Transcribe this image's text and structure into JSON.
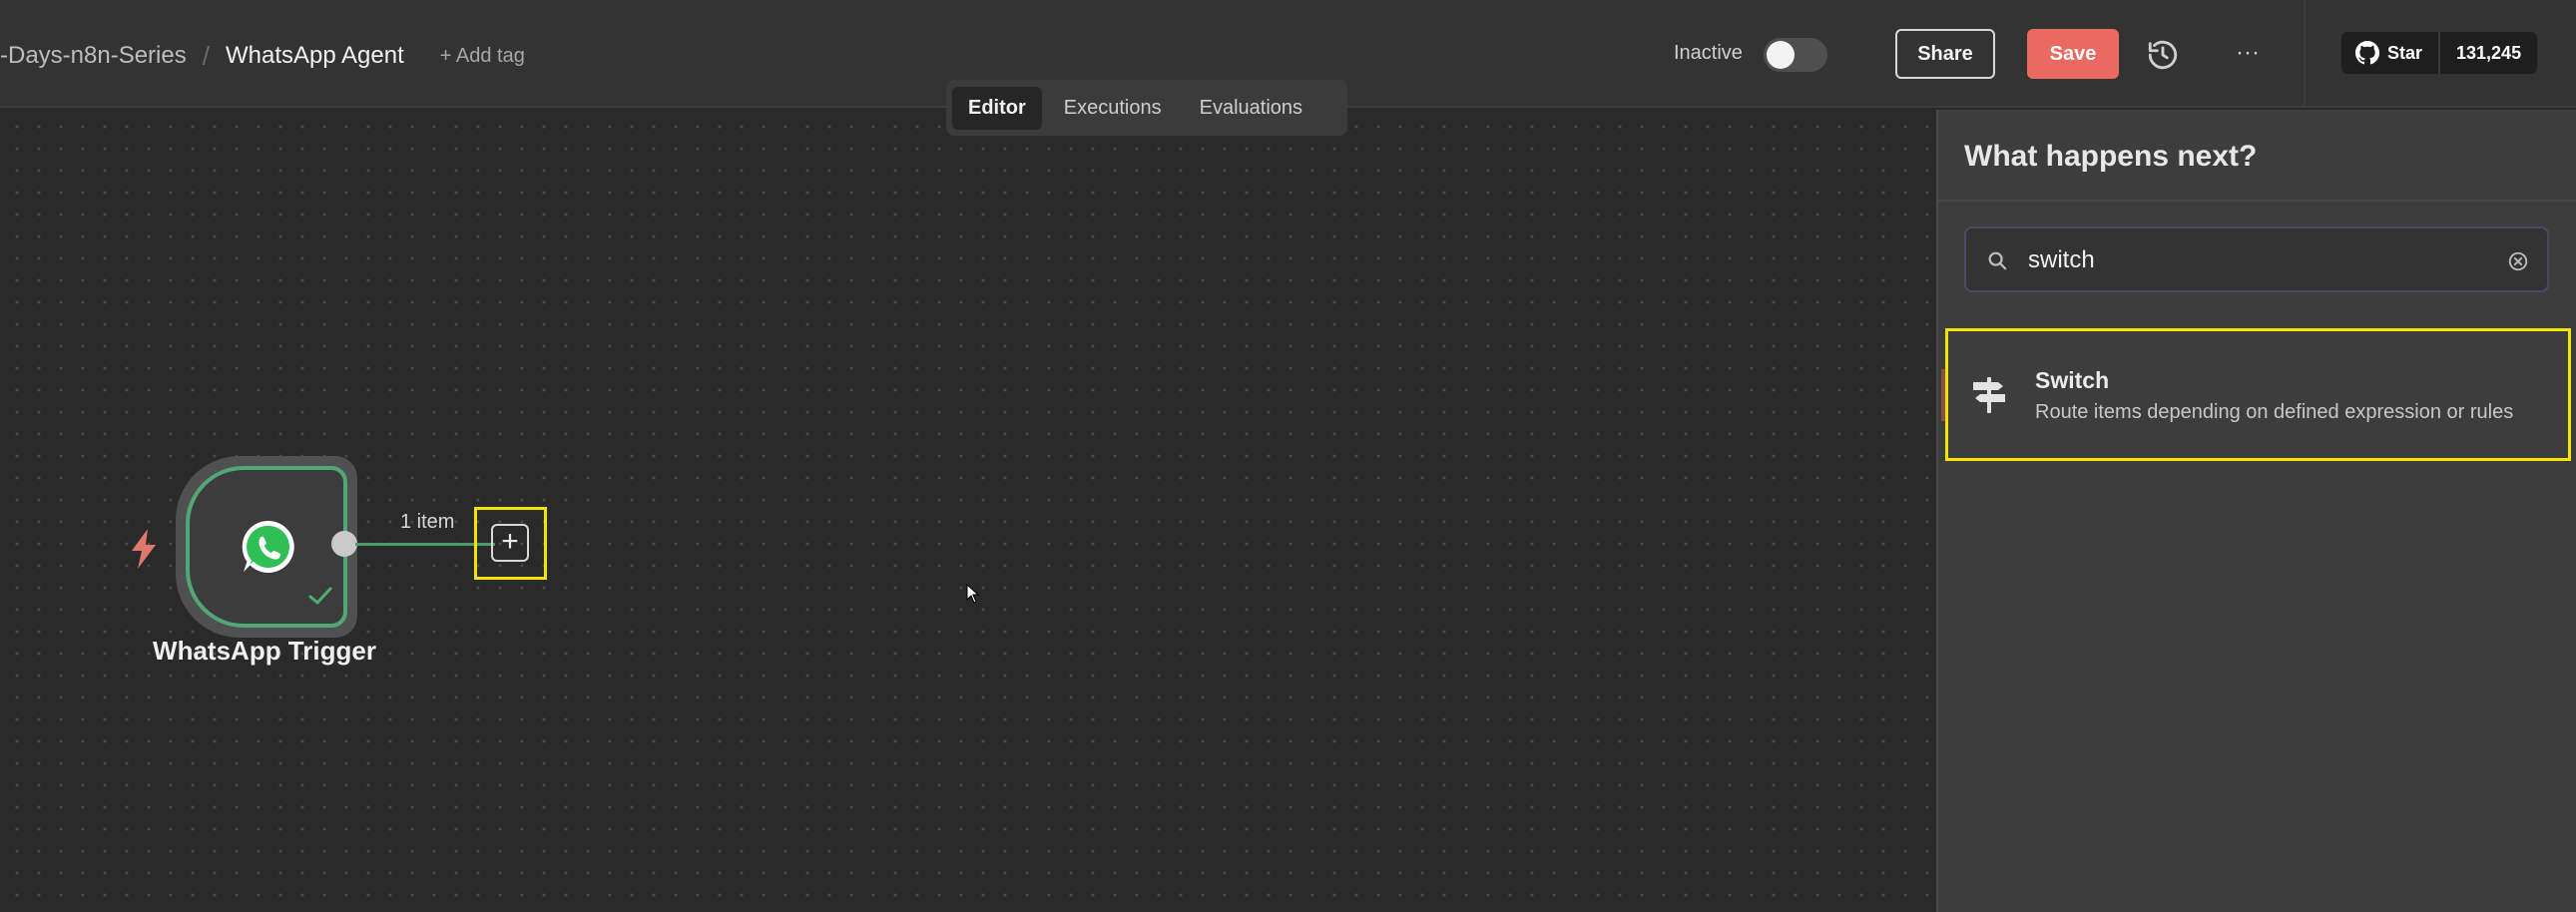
{
  "header": {
    "breadcrumb_parent": "-Days-n8n-Series",
    "breadcrumb_separator": "/",
    "workflow_name": "WhatsApp Agent",
    "add_tag_label": "+ Add tag",
    "status_label": "Inactive",
    "active": false,
    "share_label": "Share",
    "save_label": "Save",
    "more_label": "···",
    "github": {
      "star_label": "Star",
      "star_count": "131,245"
    }
  },
  "tabs": [
    {
      "label": "Editor",
      "active": true
    },
    {
      "label": "Executions",
      "active": false
    },
    {
      "label": "Evaluations",
      "active": false
    }
  ],
  "canvas": {
    "node": {
      "name": "WhatsApp Trigger",
      "icon": "whatsapp-icon",
      "status": "success"
    },
    "connection_label": "1 item",
    "add_node_label": "+"
  },
  "panel": {
    "title": "What happens next?",
    "search": {
      "value": "switch",
      "placeholder": ""
    },
    "results": [
      {
        "icon": "signpost-icon",
        "title": "Switch",
        "description": "Route items depending on defined expression or rules"
      }
    ]
  },
  "colors": {
    "save_button": "#ea6a61",
    "node_border": "#53a675",
    "highlight": "#f2e300",
    "canvas_bg": "#2a2a2a",
    "panel_bg": "#3d3d3d"
  }
}
